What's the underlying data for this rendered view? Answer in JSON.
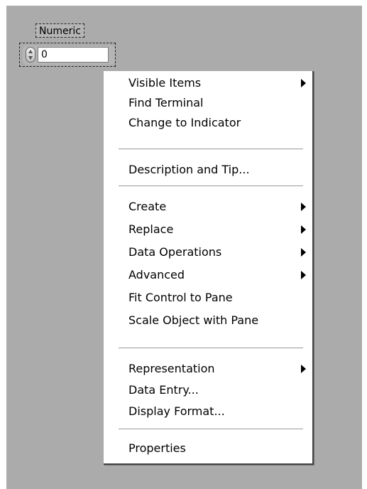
{
  "control": {
    "label": "Numeric",
    "value": "0",
    "icon": "increment-decrement-spinner-icon"
  },
  "menu": {
    "submenu_icon": "submenu-arrow-icon",
    "items": [
      {
        "label": "Visible Items",
        "submenu": true
      },
      {
        "label": "Find Terminal",
        "submenu": false
      },
      {
        "label": "Change to Indicator",
        "submenu": false
      },
      {
        "label": "Description and Tip...",
        "submenu": false
      },
      {
        "label": "Create",
        "submenu": true
      },
      {
        "label": "Replace",
        "submenu": true
      },
      {
        "label": "Data Operations",
        "submenu": true
      },
      {
        "label": "Advanced",
        "submenu": true
      },
      {
        "label": "Fit Control to Pane",
        "submenu": false
      },
      {
        "label": "Scale Object with Pane",
        "submenu": false
      },
      {
        "label": "Representation",
        "submenu": true
      },
      {
        "label": "Data Entry...",
        "submenu": false
      },
      {
        "label": "Display Format...",
        "submenu": false
      },
      {
        "label": "Properties",
        "submenu": false
      }
    ]
  },
  "colors": {
    "panel_background": "#ababab",
    "menu_background": "#ffffff",
    "separator": "#9a9a9a"
  }
}
